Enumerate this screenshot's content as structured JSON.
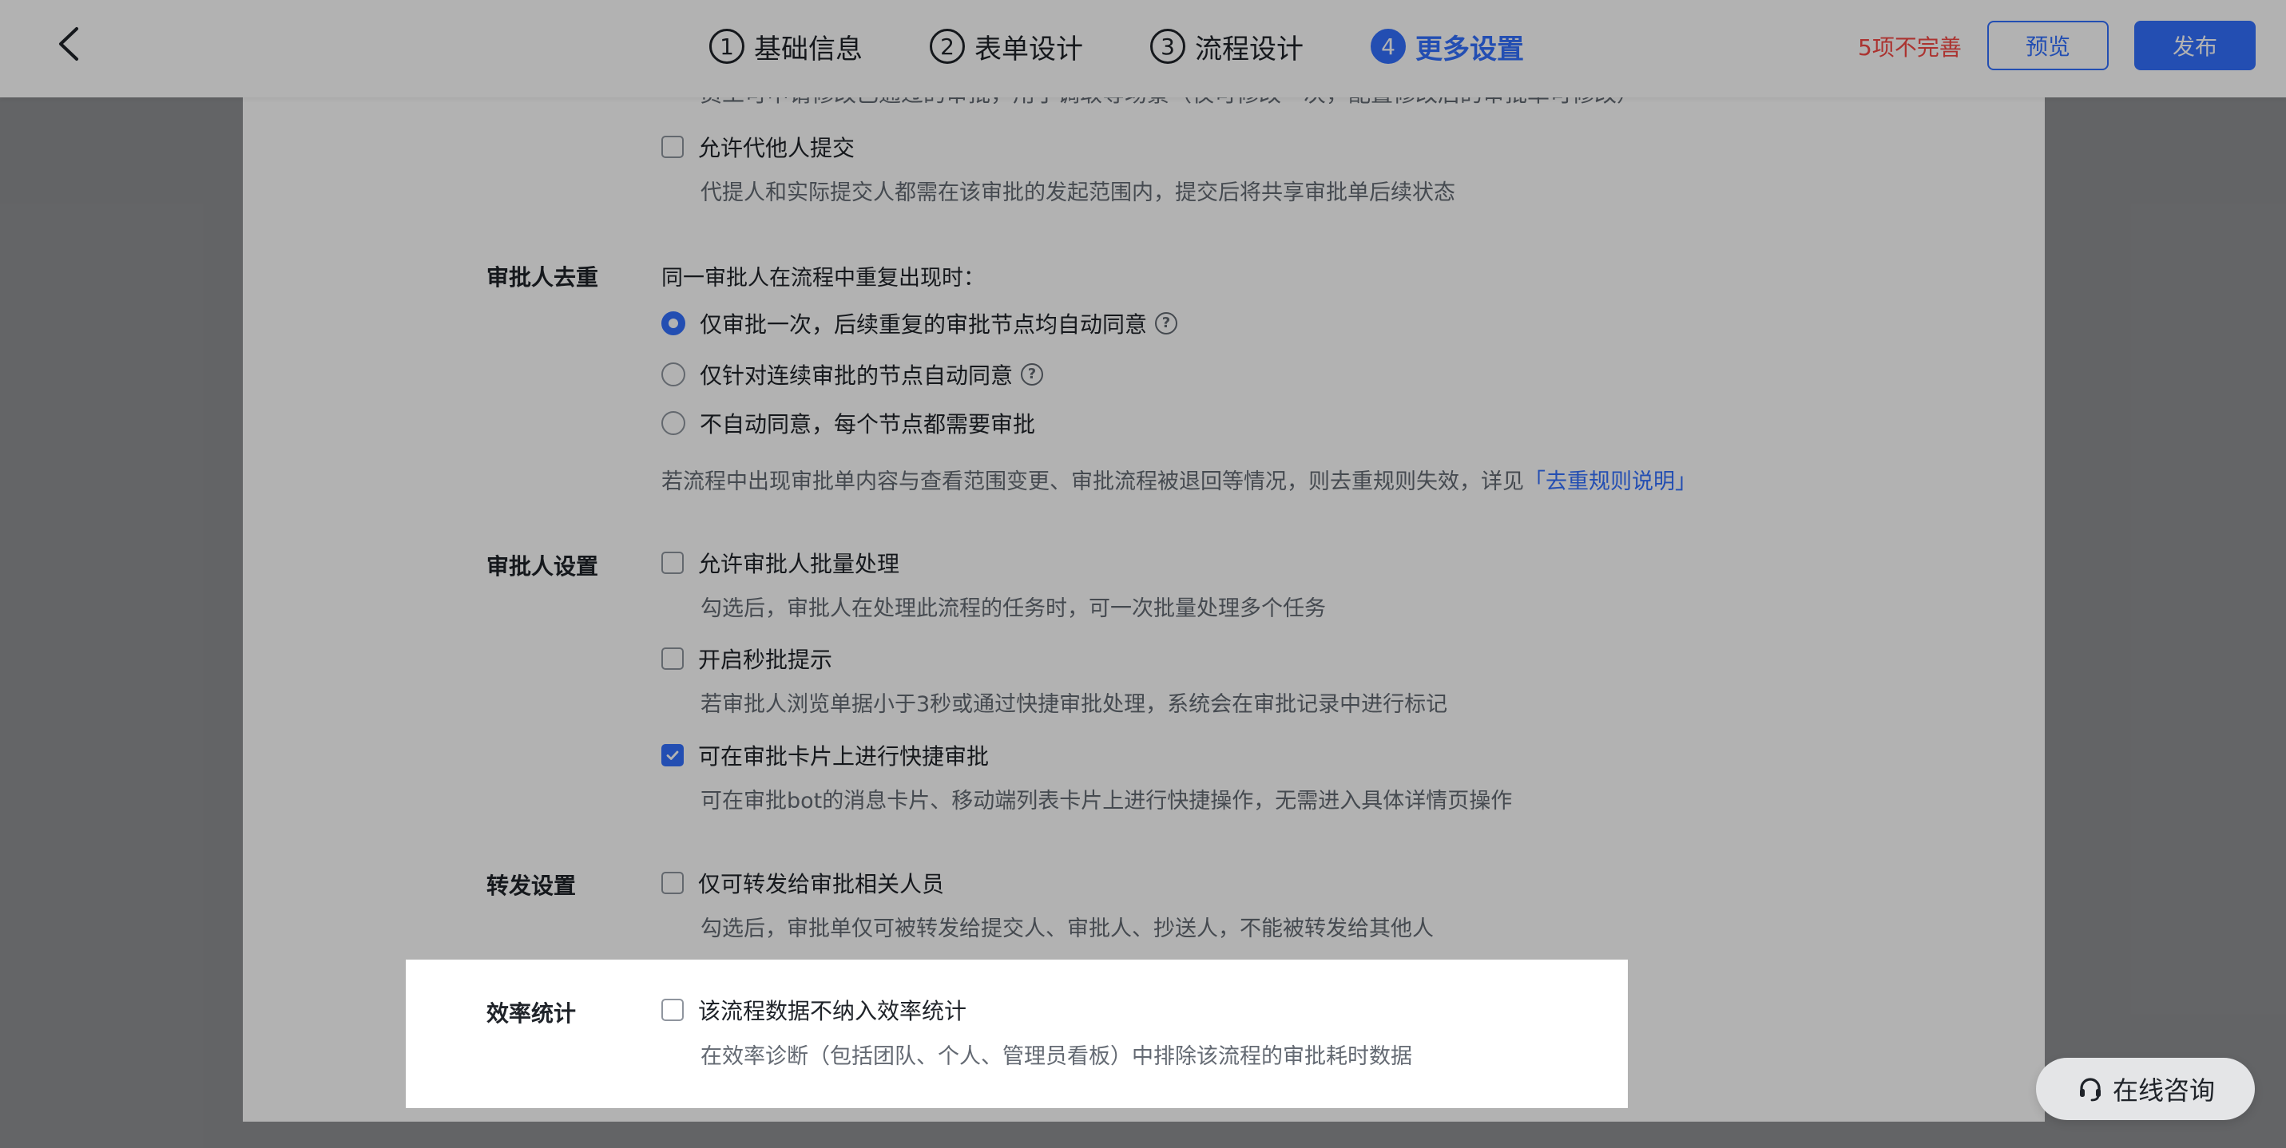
{
  "header": {
    "steps": [
      {
        "num": "1",
        "label": "基础信息"
      },
      {
        "num": "2",
        "label": "表单设计"
      },
      {
        "num": "3",
        "label": "流程设计"
      },
      {
        "num": "4",
        "label": "更多设置"
      }
    ],
    "active_step": 4,
    "incomplete_text": "5项不完善",
    "preview_label": "预览",
    "publish_label": "发布"
  },
  "top_cutoff_text": "员工可申请修改已通过的审批，用于调取等场景（仅可修改一次，配置修改后的审批单可修改）",
  "submit": {
    "allow_proxy_label": "允许代他人提交",
    "allow_proxy_desc": "代提人和实际提交人都需在该审批的发起范围内，提交后将共享审批单后续状态"
  },
  "dedup": {
    "label": "审批人去重",
    "intro": "同一审批人在流程中重复出现时：",
    "options": [
      "仅审批一次，后续重复的审批节点均自动同意",
      "仅针对连续审批的节点自动同意",
      "不自动同意，每个节点都需要审批"
    ],
    "selected_index": 0,
    "note_prefix": "若流程中出现审批单内容与查看范围变更、审批流程被退回等情况，则去重规则失效，详见",
    "note_link": "「去重规则说明」"
  },
  "approver": {
    "label": "审批人设置",
    "batch_label": "允许审批人批量处理",
    "batch_desc": "勾选后，审批人在处理此流程的任务时，可一次批量处理多个任务",
    "quick_label": "开启秒批提示",
    "quick_desc": "若审批人浏览单据小于3秒或通过快捷审批处理，系统会在审批记录中进行标记",
    "card_label": "可在审批卡片上进行快捷审批",
    "card_desc": "可在审批bot的消息卡片、移动端列表卡片上进行快捷操作，无需进入具体详情页操作",
    "card_checked": true
  },
  "forward": {
    "label": "转发设置",
    "option_label": "仅可转发给审批相关人员",
    "option_desc": "勾选后，审批单仅可被转发给提交人、审批人、抄送人，不能被转发给其他人"
  },
  "efficiency": {
    "label": "效率统计",
    "option_label": "该流程数据不纳入效率统计",
    "option_desc": "在效率诊断（包括团队、个人、管理员看板）中排除该流程的审批耗时数据"
  },
  "consult_label": "在线咨询",
  "icons": {
    "back": "chevron-left-icon",
    "help": "question-circle-icon",
    "check": "checkmark-icon",
    "headset": "headset-icon"
  },
  "colors": {
    "primary": "#3370ff",
    "warning": "#f54a45"
  }
}
